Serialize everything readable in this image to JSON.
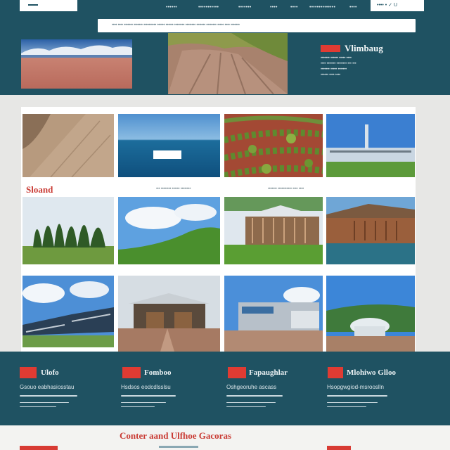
{
  "header": {
    "logo_text": "",
    "nav": [
      "••••••",
      "•••••••••••",
      "•••••••",
      "••••",
      "••••",
      "••••••••••••••",
      "••••"
    ],
    "account_label": "•••• •  ✓ U"
  },
  "search": {
    "text": "•••• •••• ••••••• ••••••• •••••••••• •••••• •••••• •••••••• •••••••• ••••••• •••••••• ••••• •••• •••••••"
  },
  "hero": {
    "headline": "Vlimbaug",
    "body_lines": [
      "••••••• •••••• ••••• ••••",
      "•••• ••••••• •••••••• ••• •••",
      "••••••• ••••• •••••••",
      "•••••• •••• ••••"
    ]
  },
  "gallery": {
    "section_title": "Sloand",
    "sub_caption_a": "••• •••••••• •••••• ••••••••",
    "sub_caption_b": "•••••••  ••••••••••• •••• ••••"
  },
  "features": [
    {
      "title": "Ulofo",
      "subtitle": "Gsouo  eabhasiosstau"
    },
    {
      "title": "Fomboo",
      "subtitle": "Hsdsos  eodcdlsslsu"
    },
    {
      "title": "Fapaughlar",
      "subtitle": "Oshgeoruhe  ascass"
    },
    {
      "title": "Mlohiwo Glloo",
      "subtitle": "Hsopgwgiod-msrooslln"
    }
  ],
  "footer": {
    "title": "Conter aand Ulfhoe Gacoras"
  },
  "colors": {
    "teal": "#1f5262",
    "red": "#e03b33",
    "background": "#e7e7e5"
  }
}
